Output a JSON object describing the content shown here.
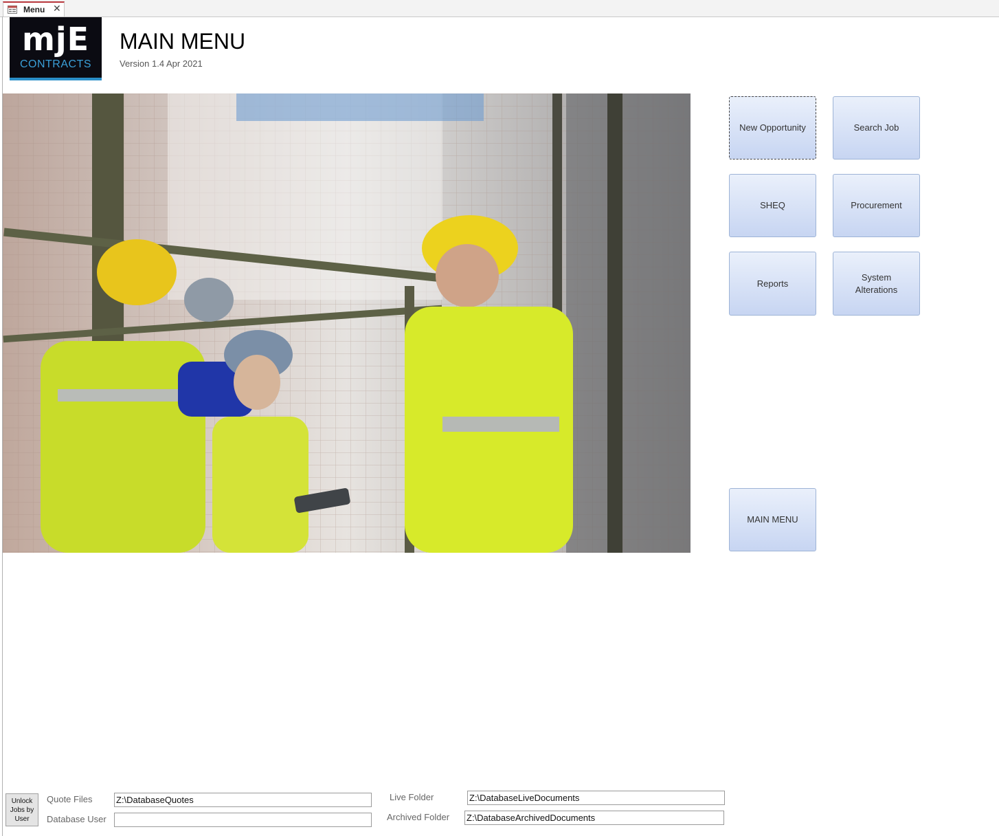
{
  "tab": {
    "label": "Menu",
    "close_glyph": "✕",
    "icon": "form-icon"
  },
  "logo": {
    "mark": "mjE",
    "sub": "CONTRACTS",
    "accent": "#2b8fc8"
  },
  "header": {
    "title": "MAIN MENU",
    "version": "Version 1.4 Apr 2021"
  },
  "photo": {
    "subject": "construction-workers-photo"
  },
  "buttons": {
    "new_opportunity": "New Opportunity",
    "search_job": "Search Job",
    "sheq": "SHEQ",
    "procurement": "Procurement",
    "reports": "Reports",
    "system_alterations": "System Alterations",
    "main_menu": "MAIN MENU"
  },
  "footer": {
    "unlock_label": "Unlock Jobs by User",
    "quote_files_label": "Quote Files",
    "quote_files_value": "Z:\\DatabaseQuotes",
    "database_user_label": "Database User",
    "database_user_value": "",
    "live_folder_label": "Live Folder",
    "live_folder_value": "Z:\\DatabaseLiveDocuments",
    "archived_folder_label": "Archived Folder",
    "archived_folder_value": "Z:\\DatabaseArchivedDocuments"
  },
  "colors": {
    "button_top": "#eaf0fb",
    "button_bottom": "#c7d5f2",
    "tab_accent": "#b8373d"
  }
}
